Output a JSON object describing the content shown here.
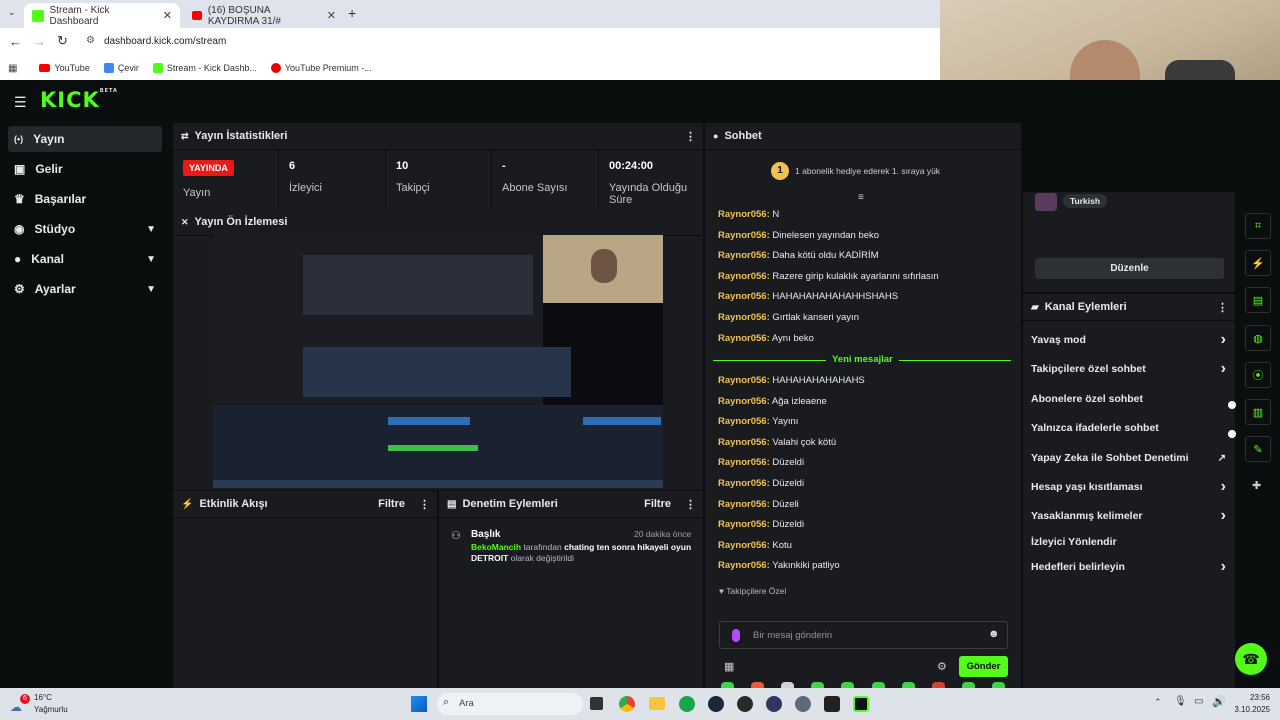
{
  "browser": {
    "tabs": [
      {
        "label": "Stream - Kick Dashboard",
        "active": true
      },
      {
        "label": "(16) BOŞUNA KAYDIRMA 31/#",
        "active": false
      }
    ],
    "url": "dashboard.kick.com/stream",
    "bookmarks": [
      "YouTube",
      "Çevir",
      "Stream - Kick Dashb...",
      "YouTube Premium -..."
    ]
  },
  "app": {
    "logo": "KICK",
    "logo_badge": "BETA"
  },
  "sidebar": {
    "items": [
      {
        "label": "Yayın",
        "icon": "broadcast-icon",
        "active": true,
        "expandable": false
      },
      {
        "label": "Gelir",
        "icon": "money-icon",
        "active": false,
        "expandable": false
      },
      {
        "label": "Başarılar",
        "icon": "trophy-icon",
        "active": false,
        "expandable": false
      },
      {
        "label": "Stüdyo",
        "icon": "studio-icon",
        "active": false,
        "expandable": true
      },
      {
        "label": "Kanal",
        "icon": "user-icon",
        "active": false,
        "expandable": true
      },
      {
        "label": "Ayarlar",
        "icon": "gear-icon",
        "active": false,
        "expandable": true
      }
    ]
  },
  "stats": {
    "title": "Yayın İstatistikleri",
    "items": [
      {
        "value": "YAYINDA",
        "label": "Yayın"
      },
      {
        "value": "6",
        "label": "İzleyici"
      },
      {
        "value": "10",
        "label": "Takipçi"
      },
      {
        "value": "-",
        "label": "Abone Sayısı"
      },
      {
        "value": "00:24:00",
        "label": "Yayında Olduğu Süre"
      }
    ]
  },
  "preview": {
    "title": "Yayın Ön İzlemesi"
  },
  "activity": {
    "title": "Etkinlik Akışı",
    "filter": "Filtre"
  },
  "moderation": {
    "title": "Denetim Eylemleri",
    "filter": "Filtre",
    "entry": {
      "heading": "Başlık",
      "time": "20 dakika önce",
      "user": "BekoMancih",
      "text1": " tarafından ",
      "old": "chating ten sonra hikayeli oyun",
      "new": "DETROIT",
      "text2": " olarak değiştirildi"
    }
  },
  "chat": {
    "title": "Sohbet",
    "pinned_rank": "1",
    "pinned_text": "1 abonelik hediye ederek 1. sıraya yük",
    "messages_before": [
      {
        "user": "Raynor056:",
        "text": "N"
      },
      {
        "user": "Raynor056:",
        "text": "Dinelesen yayından beko"
      },
      {
        "user": "Raynor056:",
        "text": "Daha kötü oldu KADİRİM"
      },
      {
        "user": "Raynor056:",
        "text": "Razere girip kulaklık ayarlarını sıfırlasın"
      },
      {
        "user": "Raynor056:",
        "text": "HAHAHAHAHAHAHHSHAHS"
      },
      {
        "user": "Raynor056:",
        "text": "Gırtlak kanseri yayın"
      },
      {
        "user": "Raynor056:",
        "text": "Aynı beko"
      }
    ],
    "new_messages_label": "Yeni mesajlar",
    "messages_after": [
      {
        "user": "Raynor056:",
        "text": "HAHAHAHAHAHAHS"
      },
      {
        "user": "Raynor056:",
        "text": "Ağa izleaene"
      },
      {
        "user": "Raynor056:",
        "text": "Yayını"
      },
      {
        "user": "Raynor056:",
        "text": "Valahi çok kötü"
      },
      {
        "user": "Raynor056:",
        "text": "Düzeldi"
      },
      {
        "user": "Raynor056:",
        "text": "Düzeldi"
      },
      {
        "user": "Raynor056:",
        "text": "Düzeli"
      },
      {
        "user": "Raynor056:",
        "text": "Düzeldi"
      },
      {
        "user": "Raynor056:",
        "text": "Kotu"
      },
      {
        "user": "Raynor056:",
        "text": "Yakınkiki patliyo"
      }
    ],
    "emote_label": "Takipçilere Özel",
    "input_placeholder": "Bir mesaj gönderin",
    "send_label": "Gönder"
  },
  "channel": {
    "language_tag": "Turkish",
    "edit_label": "Düzenle",
    "actions_title": "Kanal Eylemleri",
    "actions": [
      {
        "label": "Yavaş mod",
        "control": "chevron"
      },
      {
        "label": "Takipçilere özel sohbet",
        "control": "chevron"
      },
      {
        "label": "Abonelere özel sohbet",
        "control": "toggle"
      },
      {
        "label": "Yalnızca ifadelerle sohbet",
        "control": "toggle"
      },
      {
        "label": "Yapay Zeka ile Sohbet Denetimi",
        "control": "external"
      },
      {
        "label": "Hesap yaşı kısıtlaması",
        "control": "chevron"
      },
      {
        "label": "Yasaklanmış kelimeler",
        "control": "chevron"
      },
      {
        "label": "İzleyici Yönlendir",
        "control": "none"
      },
      {
        "label": "Hedefleri belirleyin",
        "control": "chevron"
      }
    ]
  },
  "taskbar": {
    "weather_temp": "16°C",
    "weather_desc": "Yağmurlu",
    "weather_badge": "6",
    "search_placeholder": "Ara",
    "time": "23:56",
    "date": "3.10.2025"
  },
  "colors": {
    "accent": "#53fc18",
    "live": "#e91916",
    "username": "#f2c14e",
    "panel": "#191b1f",
    "background": "#0b0e0f"
  }
}
